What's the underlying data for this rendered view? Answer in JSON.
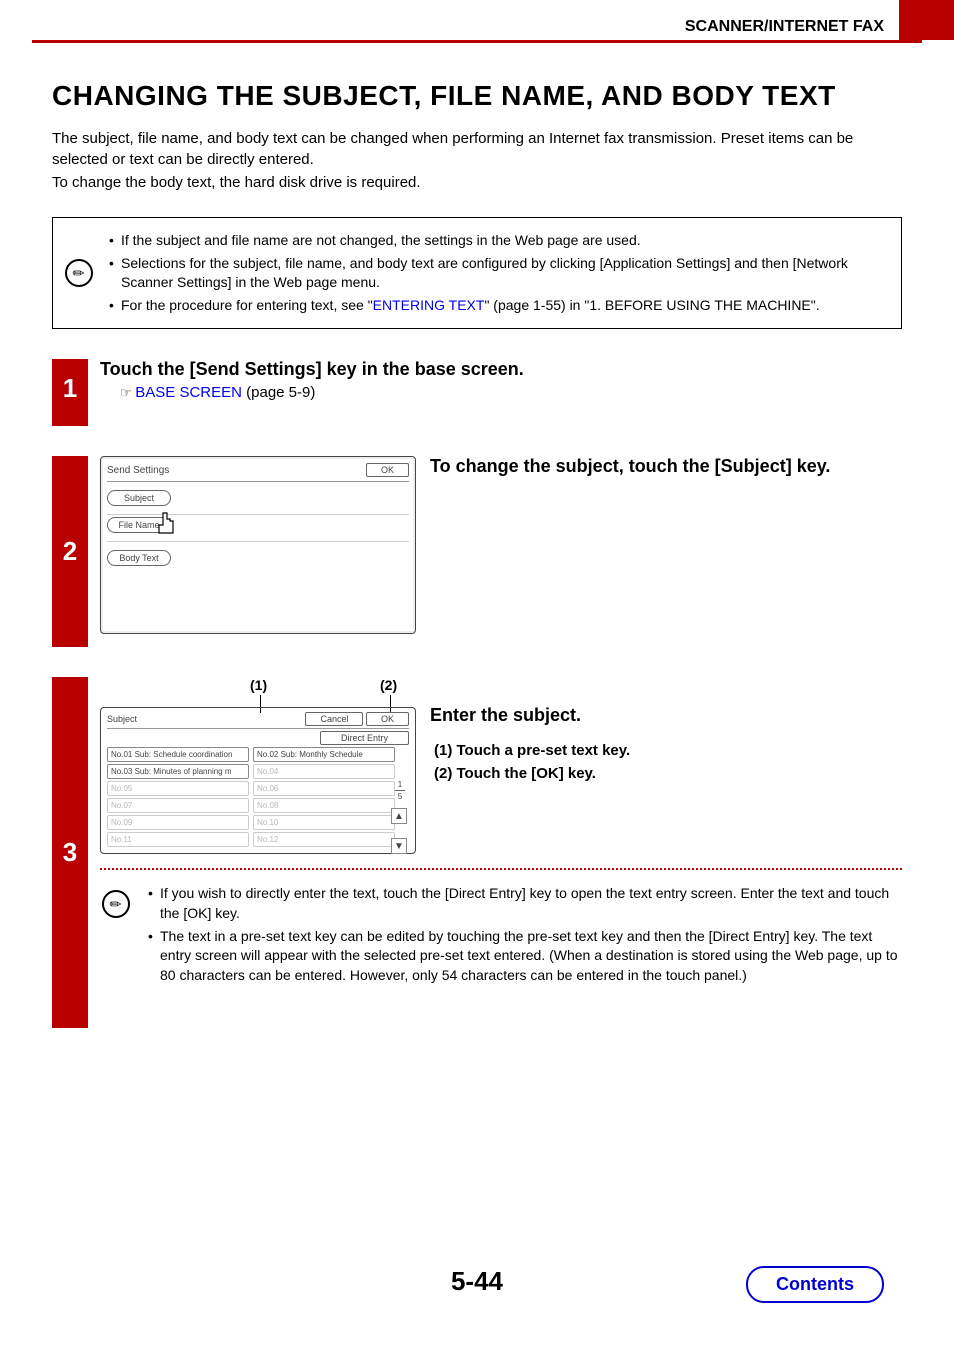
{
  "header": {
    "section": "SCANNER/INTERNET FAX"
  },
  "title": "CHANGING THE SUBJECT, FILE NAME, AND BODY TEXT",
  "intro": {
    "p1": "The subject, file name, and body text can be changed when performing an Internet fax transmission. Preset items can be selected or text can be directly entered.",
    "p2": "To change the body text, the hard disk drive is required."
  },
  "notebox": {
    "b1": "If the subject and file name are not changed, the settings in the Web page are used.",
    "b2": "Selections for the subject, file name, and body text are configured by clicking [Application Settings] and then [Network Scanner Settings] in the Web page menu.",
    "b3a": "For the procedure for entering text, see \"",
    "b3link": "ENTERING TEXT",
    "b3b": "\" (page 1-55) in \"1. BEFORE USING THE MACHINE\"."
  },
  "step1": {
    "num": "1",
    "title": "Touch the [Send Settings] key in the base screen.",
    "linktext": "BASE SCREEN",
    "linksuffix": " (page 5-9)"
  },
  "step2": {
    "num": "2",
    "instruction": "To change the subject, touch the [Subject] key.",
    "panel": {
      "title": "Send Settings",
      "ok": "OK",
      "subject": "Subject",
      "filename": "File Name",
      "bodytext": "Body Text"
    }
  },
  "step3": {
    "num": "3",
    "callout1": "(1)",
    "callout2": "(2)",
    "instruction_title": "Enter the subject.",
    "inst1": "(1)  Touch a pre-set text key.",
    "inst2": "(2)  Touch the [OK] key.",
    "panel": {
      "title": "Subject",
      "cancel": "Cancel",
      "ok": "OK",
      "direct": "Direct Entry",
      "presets": [
        "No.01 Sub: Schedule coordination",
        "No.02 Sub: Monthly Schedule",
        "No.03 Sub: Minutes of planning m",
        "No.04",
        "No.05",
        "No.06",
        "No.07",
        "No.08",
        "No.09",
        "No.10",
        "No.11",
        "No.12"
      ],
      "page_cur": "1",
      "page_tot": "5"
    },
    "notes": {
      "n1": "If you wish to directly enter the text, touch the [Direct Entry] key to open the text entry screen. Enter the text and touch the [OK] key.",
      "n2": "The text in a pre-set text key can be edited by touching the pre-set text key and then the [Direct Entry] key. The text entry screen will appear with the selected pre-set text entered. (When a destination is stored using the Web page, up to 80 characters can be entered. However, only 54 characters can be entered in the touch panel.)"
    }
  },
  "footer": {
    "page": "5-44",
    "contents": "Contents"
  }
}
